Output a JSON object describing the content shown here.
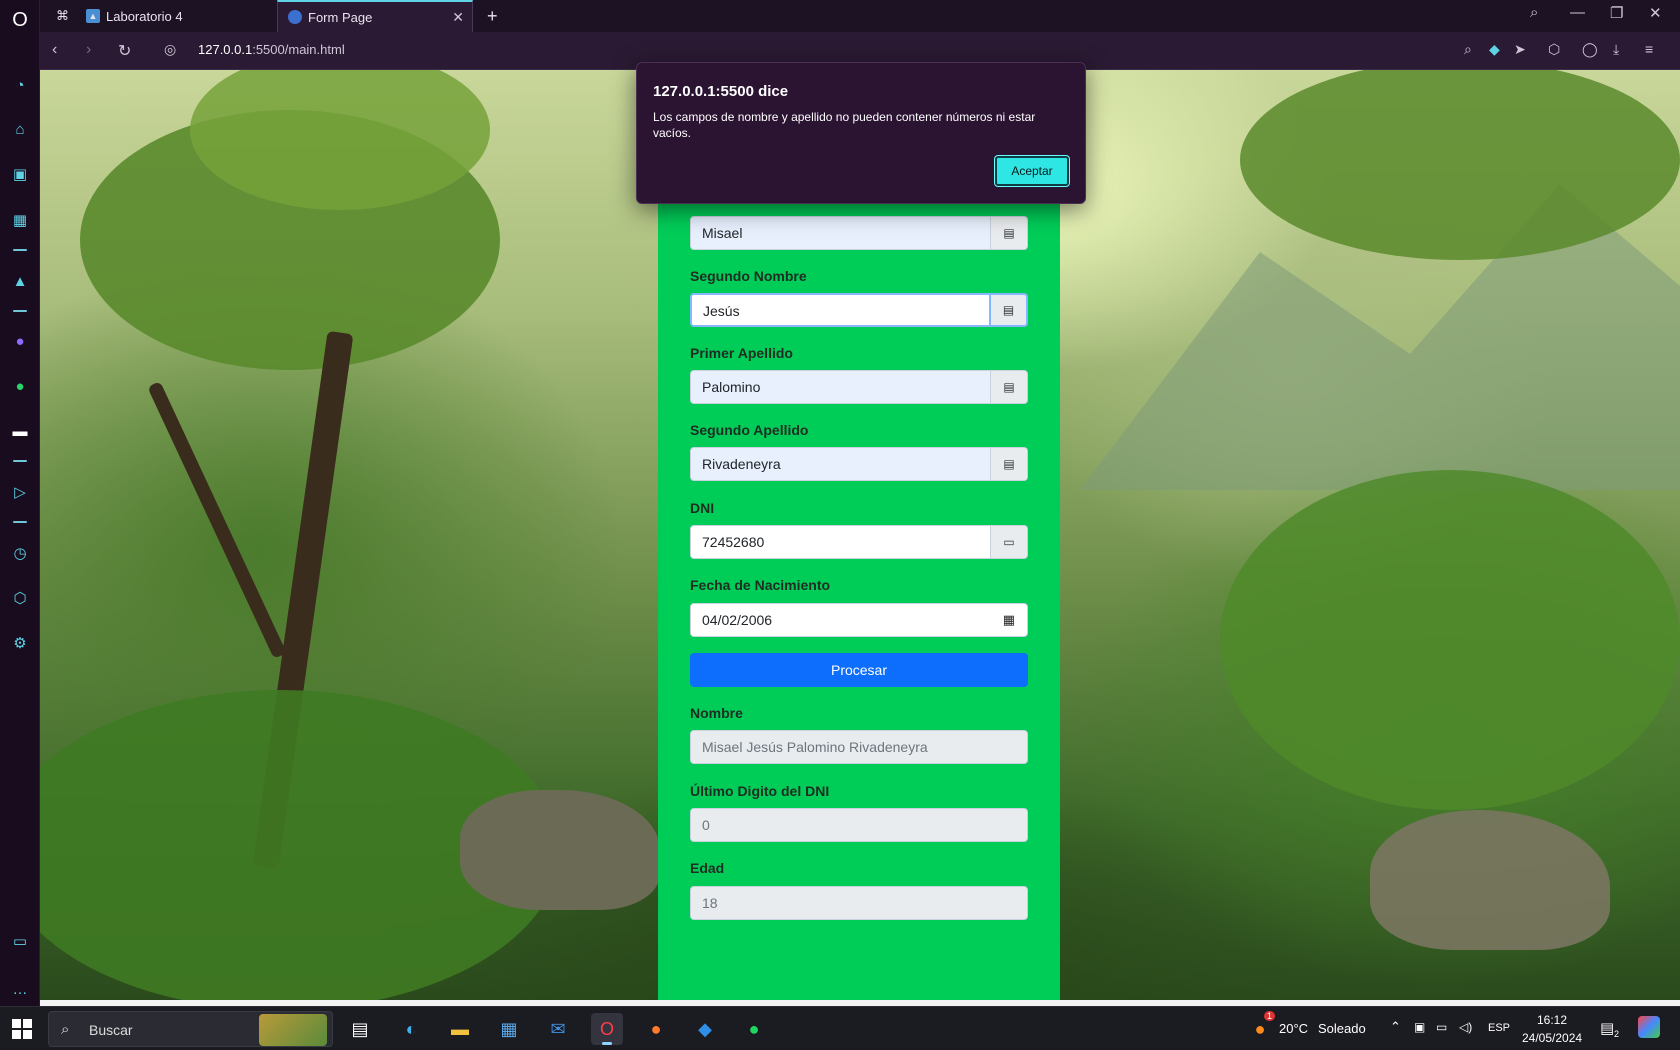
{
  "browser": {
    "tabs": [
      {
        "label": "Laboratorio 4"
      },
      {
        "label": "Form Page"
      }
    ],
    "url_host": "127.0.0.1",
    "url_path": ":5500/main.html"
  },
  "dialog": {
    "title": "127.0.0.1:5500 dice",
    "message": "Los campos de nombre y apellido no pueden contener números ni estar vacíos.",
    "button": "Aceptar"
  },
  "form": {
    "primer_nombre_value": "Misael",
    "segundo_nombre_label": "Segundo Nombre",
    "segundo_nombre_value": "Jesús",
    "primer_apellido_label": "Primer Apellido",
    "primer_apellido_value": "Palomino",
    "segundo_apellido_label": "Segundo Apellido",
    "segundo_apellido_value": "Rivadeneyra",
    "dni_label": "DNI",
    "dni_value": "72452680",
    "fecha_label": "Fecha de Nacimiento",
    "fecha_value": "04/02/2006",
    "procesar_button": "Procesar",
    "nombre_label": "Nombre",
    "nombre_value": "Misael Jesús Palomino Rivadeneyra",
    "ultimo_digito_label": "Último Digito del DNI",
    "ultimo_digito_value": "0",
    "edad_label": "Edad",
    "edad_value": "18"
  },
  "taskbar": {
    "search_placeholder": "Buscar",
    "weather_temp": "20°C",
    "weather_desc": "Soleado",
    "weather_badge": "1",
    "language": "ESP",
    "time": "16:12",
    "date": "24/05/2024",
    "notif_count": "2"
  },
  "colors": {
    "form_bg": "#00cd58",
    "primary": "#0d6efd",
    "dialog_bg": "#2b1332",
    "accent": "#2ee6e3"
  }
}
